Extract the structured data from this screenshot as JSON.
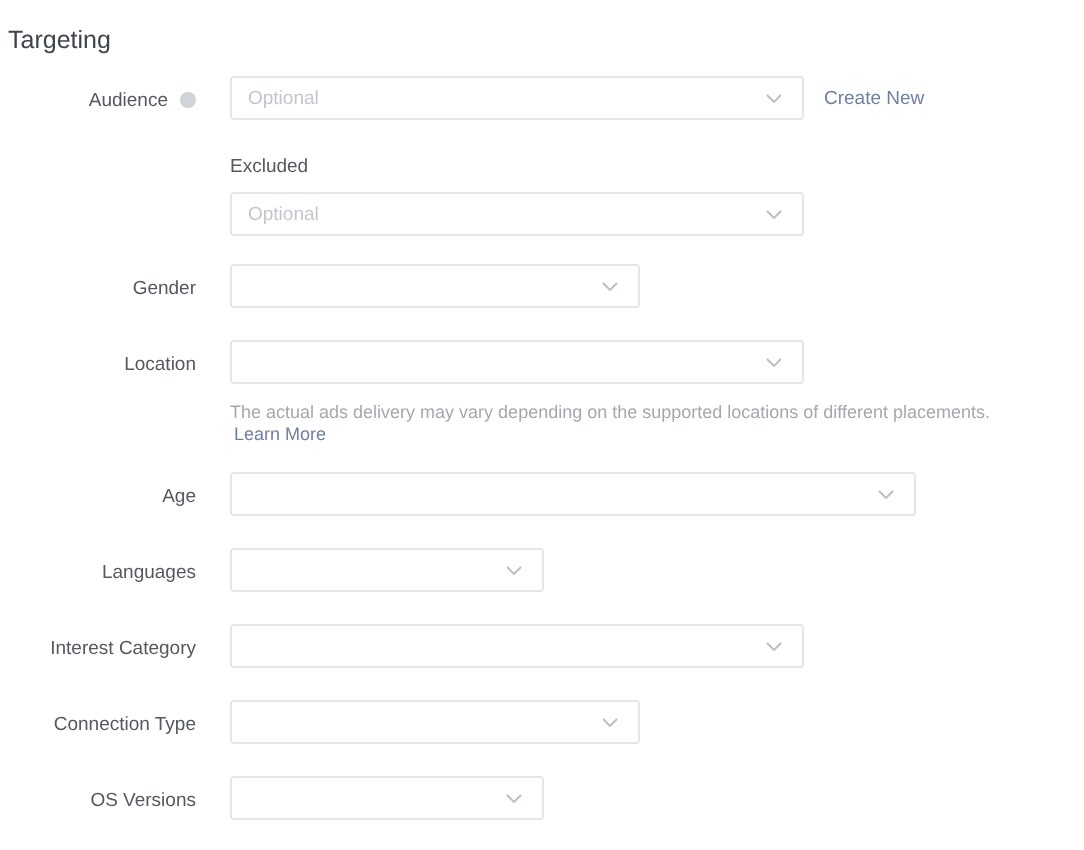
{
  "section": {
    "title": "Targeting"
  },
  "fields": [
    {
      "label": "Audience",
      "help": true,
      "placeholder": "Optional",
      "action": "Create New",
      "sub": {
        "label": "Excluded",
        "placeholder": "Optional"
      }
    },
    {
      "label": "Gender",
      "help": false
    },
    {
      "label": "Location",
      "help": false,
      "note": "The actual ads delivery may vary depending on the supported locations of different placements.",
      "note_link": "Learn More"
    },
    {
      "label": "Age",
      "help": false
    },
    {
      "label": "Languages",
      "help": false
    },
    {
      "label": "Interest Category",
      "help": false
    },
    {
      "label": "Connection Type",
      "help": false
    },
    {
      "label": "OS Versions",
      "help": false
    }
  ]
}
